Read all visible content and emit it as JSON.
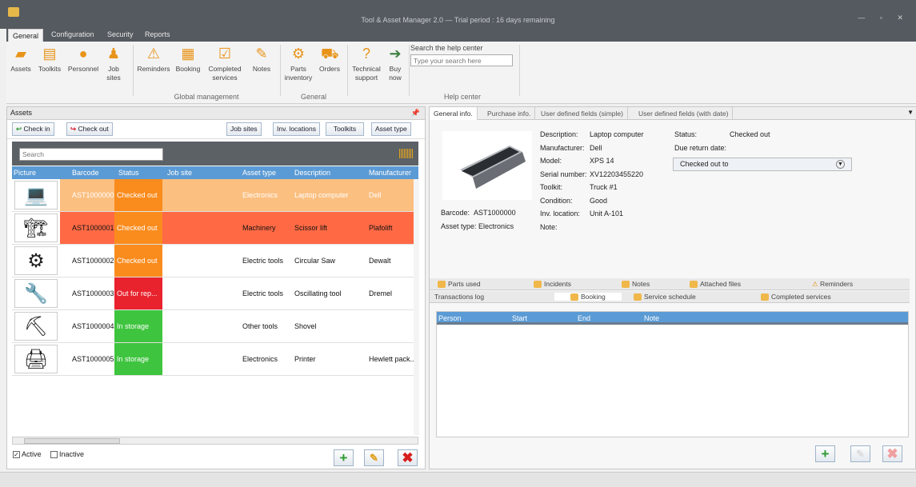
{
  "window": {
    "title": "Tool & Asset Manager 2.0 — Trial period : 16 days remaining"
  },
  "menu_tabs": [
    "General",
    "Configuration",
    "Security",
    "Reports"
  ],
  "ribbon": {
    "global": {
      "assets": "Assets",
      "toolkits": "Toolkits",
      "personnel": "Personnel",
      "job_sites_1": "Job",
      "job_sites_2": "sites",
      "reminders": "Reminders",
      "booking": "Booking",
      "completed_1": "Completed",
      "completed_2": "services",
      "notes": "Notes",
      "label": "Global management"
    },
    "general": {
      "parts_1": "Parts",
      "parts_2": "inventory",
      "orders": "Orders",
      "label": "General"
    },
    "support": {
      "tech_1": "Technical",
      "tech_2": "support",
      "buy_1": "Buy",
      "buy_2": "now"
    },
    "help": {
      "label": "Search the help center",
      "placeholder": "Type your search here",
      "group": "Help center"
    }
  },
  "assets_panel": {
    "title": "Assets",
    "check_in": "Check in",
    "check_out": "Check out",
    "filters": {
      "job_sites": "Job sites",
      "inv_locations": "Inv. locations",
      "toolkits": "Toolkits",
      "asset_type": "Asset type"
    },
    "search_placeholder": "Search",
    "columns": [
      "Picture",
      "Barcode",
      "Status",
      "Job site",
      "Asset type",
      "Description",
      "Manufacturer"
    ],
    "rows": [
      {
        "barcode": "AST1000000",
        "status": "Checked out",
        "job_site": "",
        "type": "Electronics",
        "desc": "Laptop computer",
        "mfr": "Dell",
        "row_bg": "#fbbf80",
        "status_bg": "#fa8c1e",
        "fg": "#fff",
        "icon": "laptop-icon"
      },
      {
        "barcode": "AST1000001",
        "status": "Checked out",
        "job_site": "",
        "type": "Machinery",
        "desc": "Scissor lift",
        "mfr": "Plafolift",
        "row_bg": "#ff6a45",
        "status_bg": "#fa8c1e",
        "fg": "#111",
        "icon": "scissor-lift-icon"
      },
      {
        "barcode": "AST1000002",
        "status": "Checked out",
        "job_site": "",
        "type": "Electric tools",
        "desc": "Circular Saw",
        "mfr": "Dewalt",
        "row_bg": "#ffffff",
        "status_bg": "#fa8c1e",
        "fg": "#111",
        "icon": "saw-icon"
      },
      {
        "barcode": "AST1000003",
        "status": "Out for rep...",
        "job_site": "",
        "type": "Electric tools",
        "desc": "Oscillating tool",
        "mfr": "Dremel",
        "row_bg": "#ffffff",
        "status_bg": "#e8232e",
        "fg": "#111",
        "icon": "tool-icon"
      },
      {
        "barcode": "AST1000004",
        "status": "In storage",
        "job_site": "",
        "type": "Other tools",
        "desc": "Shovel",
        "mfr": "",
        "row_bg": "#ffffff",
        "status_bg": "#3fc43f",
        "fg": "#111",
        "icon": "shovel-icon"
      },
      {
        "barcode": "AST1000005",
        "status": "In storage",
        "job_site": "",
        "type": "Electronics",
        "desc": "Printer",
        "mfr": "Hewlett pack...",
        "row_bg": "#ffffff",
        "status_bg": "#3fc43f",
        "fg": "#111",
        "icon": "printer-icon"
      }
    ],
    "active": "Active",
    "inactive": "Inactive"
  },
  "detail_panel": {
    "tabs": [
      "General info.",
      "Purchase info.",
      "User defined fields (simple)",
      "User defined fields (with date)"
    ],
    "barcode_label": "Barcode:",
    "barcode": "AST1000000",
    "asset_type_label": "Asset type:",
    "asset_type": "Electronics",
    "labels": [
      "Description:",
      "Manufacturer:",
      "Model:",
      "Serial number:",
      "Toolkit:",
      "Condition:",
      "Inv. location:",
      "Note:"
    ],
    "values": [
      "Laptop computer",
      "Dell",
      "XPS 14",
      "XV12203455220",
      "Truck #1",
      "Good",
      "Unit A-101",
      ""
    ],
    "status_label": "Status:",
    "status": "Checked out",
    "due_label": "Due return date:",
    "dropdown": "Checked out to",
    "lower_tabs_1": [
      "Parts used",
      "Incidents",
      "Notes",
      "Attached files",
      "Reminders"
    ],
    "lower_tabs_2": [
      "Transactions log",
      "Booking",
      "Service schedule",
      "Completed services"
    ],
    "booking_columns": [
      "Person",
      "Start",
      "End",
      "Note"
    ]
  }
}
